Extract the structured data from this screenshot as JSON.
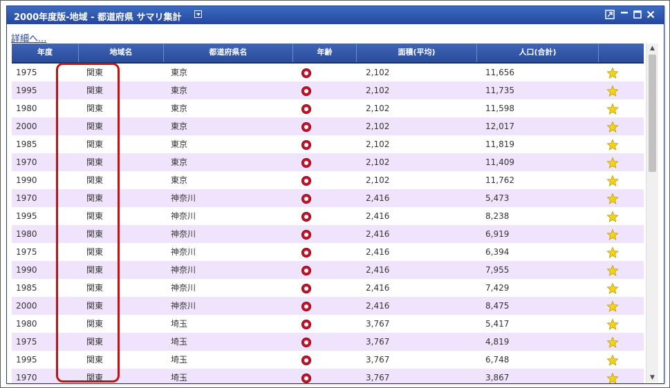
{
  "window": {
    "title": "2000年度版-地域 - 都道府県  サマリ集計",
    "detail_link": "詳細へ..."
  },
  "columns": [
    "年度",
    "地域名",
    "都道府県名",
    "年齢",
    "面積(平均)",
    "人口(合計)",
    ""
  ],
  "icons": {
    "age": "target-icon",
    "favorite": "star-icon",
    "title_menu": "dropdown-icon",
    "window_controls": [
      "popout-icon",
      "minimize-icon",
      "maximize-icon",
      "close-icon"
    ],
    "scroll_up": "scroll-up-icon",
    "scroll_down": "scroll-down-icon"
  },
  "colors": {
    "title_bar": "#2a4fa3",
    "header": "#3a5daa",
    "row_alt": "#efe4fb",
    "highlight": "#c80f0f",
    "target": "#c4142a",
    "star": "#f0d000"
  },
  "rows": [
    {
      "year": "1975",
      "region": "関東",
      "prefecture": "東京",
      "area": "2,102",
      "population": "11,656"
    },
    {
      "year": "1995",
      "region": "関東",
      "prefecture": "東京",
      "area": "2,102",
      "population": "11,735"
    },
    {
      "year": "1980",
      "region": "関東",
      "prefecture": "東京",
      "area": "2,102",
      "population": "11,598"
    },
    {
      "year": "2000",
      "region": "関東",
      "prefecture": "東京",
      "area": "2,102",
      "population": "12,017"
    },
    {
      "year": "1985",
      "region": "関東",
      "prefecture": "東京",
      "area": "2,102",
      "population": "11,819"
    },
    {
      "year": "1970",
      "region": "関東",
      "prefecture": "東京",
      "area": "2,102",
      "population": "11,409"
    },
    {
      "year": "1990",
      "region": "関東",
      "prefecture": "東京",
      "area": "2,102",
      "population": "11,762"
    },
    {
      "year": "1970",
      "region": "関東",
      "prefecture": "神奈川",
      "area": "2,416",
      "population": "5,473"
    },
    {
      "year": "1995",
      "region": "関東",
      "prefecture": "神奈川",
      "area": "2,416",
      "population": "8,238"
    },
    {
      "year": "1980",
      "region": "関東",
      "prefecture": "神奈川",
      "area": "2,416",
      "population": "6,919"
    },
    {
      "year": "1975",
      "region": "関東",
      "prefecture": "神奈川",
      "area": "2,416",
      "population": "6,394"
    },
    {
      "year": "1990",
      "region": "関東",
      "prefecture": "神奈川",
      "area": "2,416",
      "population": "7,955"
    },
    {
      "year": "1985",
      "region": "関東",
      "prefecture": "神奈川",
      "area": "2,416",
      "population": "7,429"
    },
    {
      "year": "2000",
      "region": "関東",
      "prefecture": "神奈川",
      "area": "2,416",
      "population": "8,475"
    },
    {
      "year": "1980",
      "region": "関東",
      "prefecture": "埼玉",
      "area": "3,767",
      "population": "5,417"
    },
    {
      "year": "1975",
      "region": "関東",
      "prefecture": "埼玉",
      "area": "3,767",
      "population": "4,819"
    },
    {
      "year": "1995",
      "region": "関東",
      "prefecture": "埼玉",
      "area": "3,767",
      "population": "6,748"
    },
    {
      "year": "1970",
      "region": "関東",
      "prefecture": "埼玉",
      "area": "3,767",
      "population": "3,867"
    }
  ]
}
